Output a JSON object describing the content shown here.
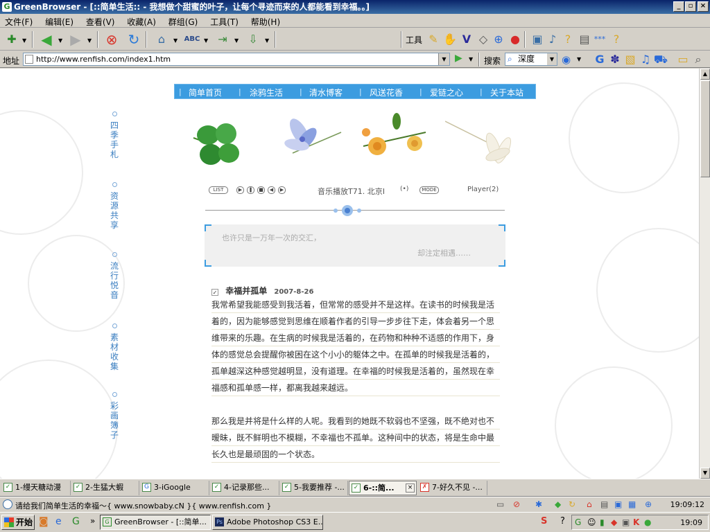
{
  "window": {
    "title": "GreenBrowser - [::简单生活:: - 我想做个甜蜜的叶子，让每个寻迹而来的人都能看到幸福。。]"
  },
  "menu": [
    "文件(F)",
    "编辑(E)",
    "查看(V)",
    "收藏(A)",
    "群组(G)",
    "工具(T)",
    "帮助(H)"
  ],
  "toolbar": {
    "tools_label": "工具"
  },
  "address_bar": {
    "label": "地址",
    "url": "http://www.renfish.com/index1.htm",
    "search_label": "搜索",
    "search_engine": "深度"
  },
  "page": {
    "left_nav": [
      {
        "label": "四季手札"
      },
      {
        "label": "资源共享"
      },
      {
        "label": "流行悦音"
      },
      {
        "label": "素材收集"
      },
      {
        "label": "彩画簿子"
      }
    ],
    "top_nav": [
      "简单首页",
      "涂鸦生活",
      "清水博客",
      "风送花香",
      "爱链之心",
      "关于本站"
    ],
    "player": {
      "list_label": "LIST",
      "now_playing": "音乐播放T71. 北京I",
      "mode_label": "MODE",
      "player_label": "Player(2)"
    },
    "quote": {
      "line1": "也许只是一万年一次的交汇，",
      "line2": "却注定相遇……"
    },
    "post": {
      "title": "幸福并孤单",
      "date": "2007-8-26",
      "para1": [
        "我常希望我能感受到我活着，但常常的感受并不是这样。在读书的时候我是活",
        "着的，因为能够感觉到思维在顺着作者的引导一步步往下走，体会着另一个思",
        "维带来的乐趣。在生病的时候我是活着的，在药物和种种不适感的作用下，身",
        "体的感觉总会提醒你被困在这个小小的躯体之中。在孤单的时候我是活着的，",
        "孤单越深这种感觉越明显，没有道理。在幸福的时候我是活着的，虽然现在幸",
        "福感和孤单感一样，都离我越来越远。"
      ],
      "para2": [
        "那么我是并将是什么样的人呢。我看到的她既不软弱也不坚强，既不绝对也不",
        "暧昧，既不鲜明也不模糊，不幸福也不孤单。这种间中的状态，将是生命中最",
        "长久也是最顽固的一个状态。"
      ]
    }
  },
  "tabs": [
    {
      "label": "1-缦天糖动漫",
      "active": false
    },
    {
      "label": "2-生猛大蝦",
      "active": false
    },
    {
      "label": "3-iGoogle",
      "active": false
    },
    {
      "label": "4-记录那些...",
      "active": false
    },
    {
      "label": "5-我要推荐 -...",
      "active": false
    },
    {
      "label": "6-::简...",
      "active": true
    },
    {
      "label": "7-好久不见 -...",
      "active": false
    }
  ],
  "status": {
    "text": "请给我们简单生活的幸福～{ www.snowbaby.cN }{ www.renfish.com }",
    "time": "19:09:12"
  },
  "taskbar": {
    "start_label": "开始",
    "tasks": [
      {
        "label": "GreenBrowser - [::简单...",
        "active": true
      },
      {
        "label": "Adobe Photoshop CS3 E...",
        "active": false
      }
    ],
    "clock": "19:09"
  },
  "colors": {
    "nav_blue": "#3c9ce0",
    "link_blue": "#3a7ec0",
    "titlebar": "#0a246a"
  }
}
